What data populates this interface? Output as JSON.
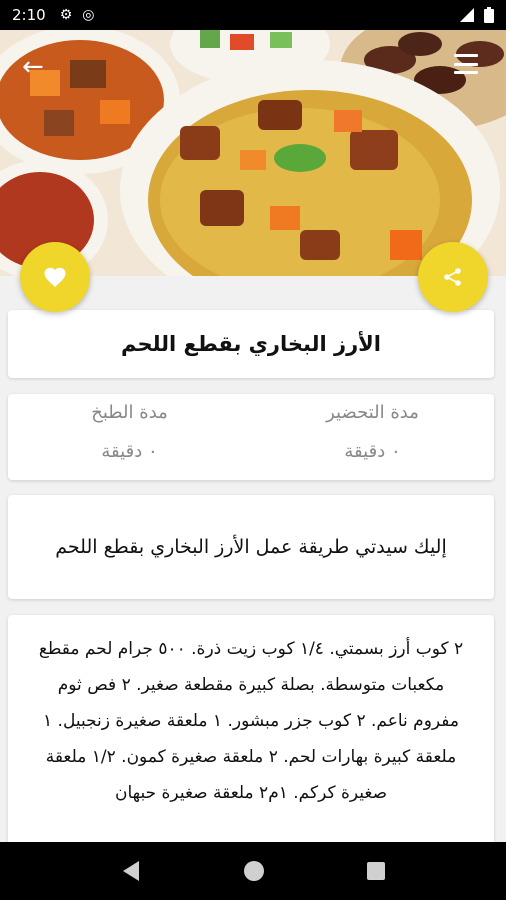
{
  "status_bar": {
    "time": "2:10"
  },
  "recipe": {
    "title": "الأرز البخاري بقطع اللحم",
    "prep_label": "مدة التحضير",
    "prep_value": "٠ دقيقة",
    "cook_label": "مدة الطبخ",
    "cook_value": "٠ دقيقة",
    "intro": "إليك سيدتي طريقة عمل الأرز البخاري بقطع اللحم",
    "ingredients": "٢ كوب أرز بسمتي. ١/٤ كوب زيت ذرة. ٥٠٠ جرام لحم مقطع مكعبات متوسطة. بصلة كبيرة مقطعة صغير. ٢ فص ثوم مفروم ناعم. ٢ كوب جزر مبشور. ١ ملعقة صغيرة زنجبيل. ١ ملعقة كبيرة بهارات لحم. ٢ ملعقة صغيرة كمون. ١/٢ ملعقة صغيرة كركم. ١م٢ ملعقة صغيرة حبهان"
  },
  "icons": {
    "back": "back-arrow-icon",
    "menu": "menu-icon",
    "favorite": "heart-icon",
    "share": "share-icon"
  },
  "colors": {
    "accent": "#f0d52a"
  }
}
